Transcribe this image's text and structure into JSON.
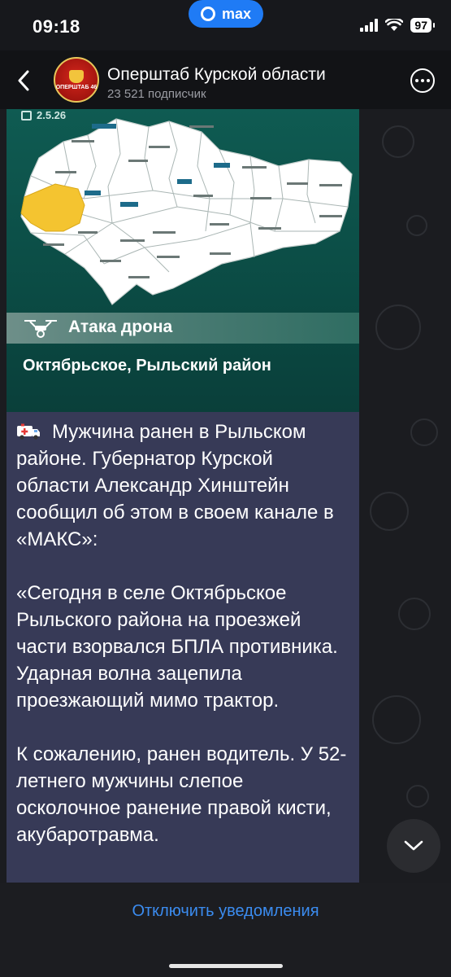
{
  "status_bar": {
    "time": "09:18",
    "app_pill_label": "max",
    "battery": "97"
  },
  "header": {
    "back_icon": "chevron-left-icon",
    "avatar_text": "ОПЕРШТАБ 46",
    "title": "Оперштаб Курской области",
    "subtitle": "23 521 подписчик",
    "more_icon": "ellipsis-circle-icon"
  },
  "map_card": {
    "date": "2.5.26",
    "attack_type": "Атака дрона",
    "location": "Октябрьское, Рыльский район",
    "highlight_color": "#f4c430",
    "background_color": "#0f5b52"
  },
  "message": {
    "paragraphs": [
      "Мужчина ранен в Рыльском районе. Губернатор Курской области Александр Хинштейн сообщил об этом в своем канале в «МАКС»:",
      "«Сегодня в селе Октябрьское Рыльского района на проезжей части взорвался БПЛА противника. Ударная волна зацепила проезжающий мимо трактор.",
      "К сожалению, ранен водитель. У 52-летнего мужчины слепое осколочное ранение правой кисти, акубаротравма."
    ]
  },
  "bottom": {
    "mute_label": "Отключить уведомления",
    "accent_color": "#3b8cf0"
  }
}
